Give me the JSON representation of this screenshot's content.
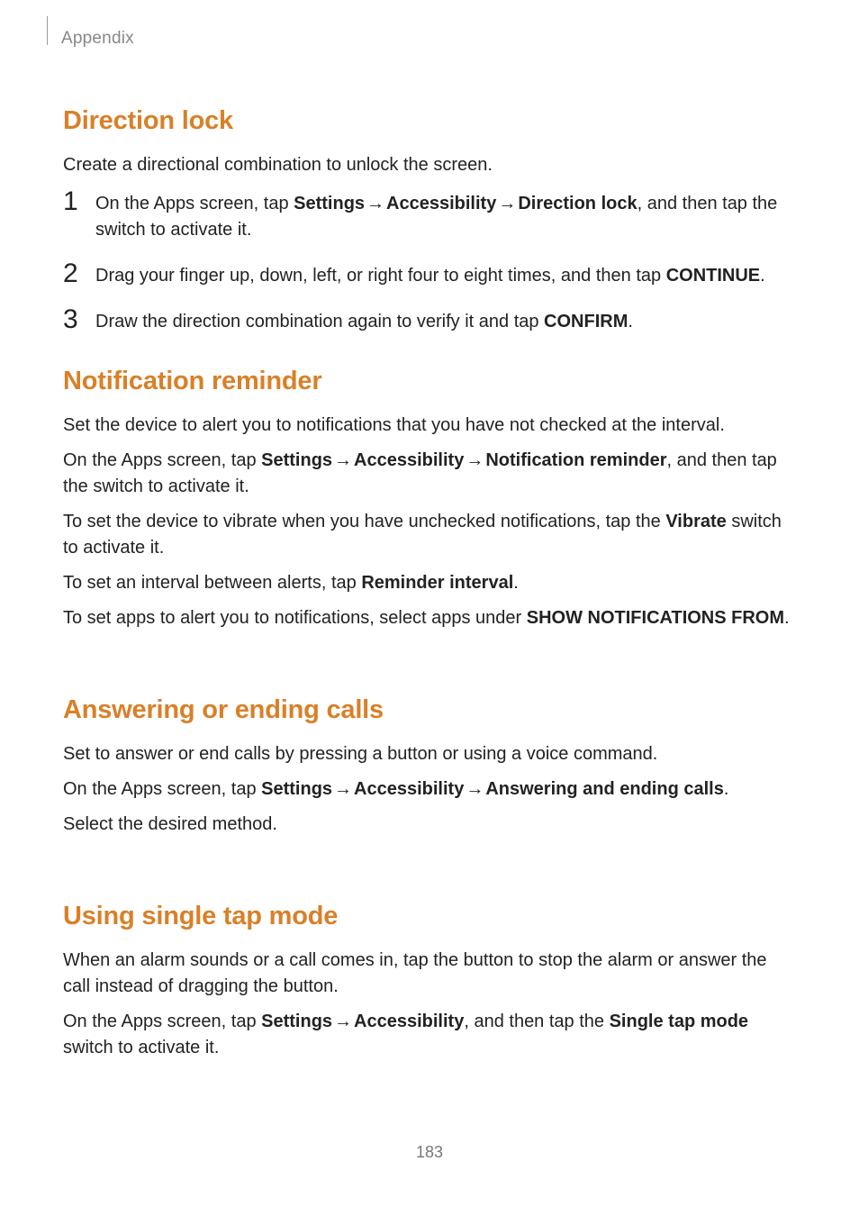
{
  "header": {
    "section": "Appendix"
  },
  "page_number": "183",
  "arrow": "→",
  "sections": {
    "direction_lock": {
      "heading": "Direction lock",
      "intro": "Create a directional combination to unlock the screen.",
      "steps": {
        "n1": "1",
        "n2": "2",
        "n3": "3",
        "s1_pre": "On the Apps screen, tap ",
        "s1_settings": "Settings",
        "s1_accessibility": "Accessibility",
        "s1_dl": "Direction lock",
        "s1_post": ", and then tap the switch to activate it.",
        "s2_pre": "Drag your finger up, down, left, or right four to eight times, and then tap ",
        "s2_cont": "CONTINUE",
        "s2_post": ".",
        "s3_pre": "Draw the direction combination again to verify it and tap ",
        "s3_conf": "CONFIRM",
        "s3_post": "."
      }
    },
    "notification_reminder": {
      "heading": "Notification reminder",
      "p1": "Set the device to alert you to notifications that you have not checked at the interval.",
      "p2_pre": "On the Apps screen, tap ",
      "p2_settings": "Settings",
      "p2_accessibility": "Accessibility",
      "p2_nr": "Notification reminder",
      "p2_post": ", and then tap the switch to activate it.",
      "p3_pre": "To set the device to vibrate when you have unchecked notifications, tap the ",
      "p3_vibrate": "Vibrate",
      "p3_post": " switch to activate it.",
      "p4_pre": "To set an interval between alerts, tap ",
      "p4_ri": "Reminder interval",
      "p4_post": ".",
      "p5_pre": "To set apps to alert you to notifications, select apps under ",
      "p5_snf": "SHOW NOTIFICATIONS FROM",
      "p5_post": "."
    },
    "answering": {
      "heading": "Answering or ending calls",
      "p1": "Set to answer or end calls by pressing a button or using a voice command.",
      "p2_pre": "On the Apps screen, tap ",
      "p2_settings": "Settings",
      "p2_accessibility": "Accessibility",
      "p2_aec": "Answering and ending calls",
      "p2_post": ".",
      "p3": "Select the desired method."
    },
    "single_tap": {
      "heading": "Using single tap mode",
      "p1": "When an alarm sounds or a call comes in, tap the button to stop the alarm or answer the call instead of dragging the button.",
      "p2_pre": "On the Apps screen, tap ",
      "p2_settings": "Settings",
      "p2_accessibility": "Accessibility",
      "p2_mid": ", and then tap the ",
      "p2_stm": "Single tap mode",
      "p2_post": " switch to activate it."
    }
  }
}
